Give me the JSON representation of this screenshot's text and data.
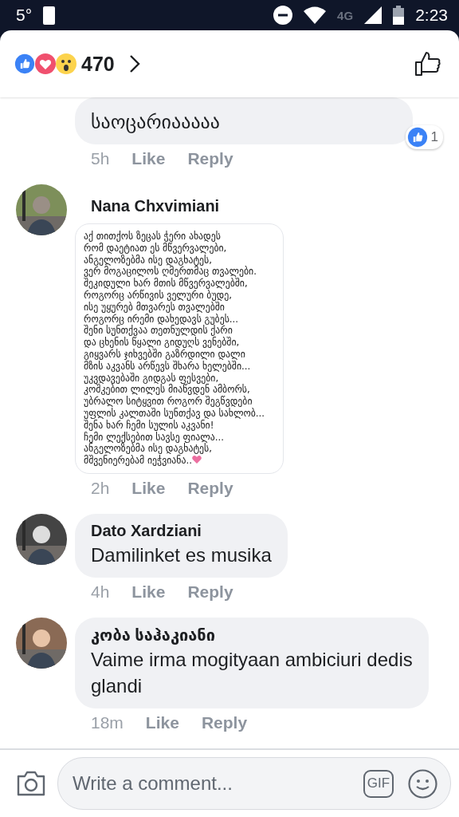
{
  "status_bar": {
    "temperature": "5°",
    "network": "4G",
    "time": "2:23"
  },
  "reactions_header": {
    "count": "470"
  },
  "comments": [
    {
      "kind": "text",
      "lines": [
        "საოცარიააააა"
      ],
      "time": "5h",
      "like": "Like",
      "reply": "Reply",
      "reaction_count": "1"
    },
    {
      "author": "Nana Chxvimiani",
      "lines": [
        "აქ თითქოს ზეცას ჭერი ახადეს",
        "რომ დაეტიათ ეს მწვერვალები,",
        "ანგელოზებმა ისე დაგხატეს,",
        "ვერ მოგაცილოს ღმერთმაც თვალები.",
        "შეკიდული ხარ მთის მწვერვალებში,",
        "როგორც არწივის ველური ბუდე,",
        "ისე უყურებ მთვარეს თვალებში",
        "როგორც ირემი დახედავს გუბეს...",
        "შენი სუნთქვაა თეთნულდის ქარი",
        "და ცხენის წყალი გიდუღს ვენებში,",
        "გიყვარს ჯიხვებში გაზრდილი დალი",
        "მზის აკვანს არწევს შხარა ხელებში...",
        "უკვდავებაში გიდგას ფესვები,",
        "კოშკებით ლილეს მიაწვდენ ამბორს,",
        "უბრალო სიტყვით როგორ შეგწვდები",
        "უფლის კალთაში სუნთქავ და სახლობ...",
        "შენა ხარ ჩემი სულის აკვანი!",
        "ჩემი ლექსებით სავსე ფიალა...",
        "ანგელოზებმა ისე დაგხატეს,",
        "მშვენიერებამ იეჭვიანა.."
      ],
      "time": "2h",
      "like": "Like",
      "reply": "Reply"
    },
    {
      "kind": "text",
      "author": "Dato Xardziani",
      "lines": [
        "Damilinket es musika"
      ],
      "time": "4h",
      "like": "Like",
      "reply": "Reply"
    },
    {
      "kind": "text",
      "author": "კობა საჰაკიანი",
      "lines": [
        "Vaime irma mogityaan ambiciuri dedis glandi"
      ],
      "time": "18m",
      "like": "Like",
      "reply": "Reply"
    }
  ],
  "composer": {
    "placeholder": "Write a comment...",
    "gif": "GIF"
  }
}
